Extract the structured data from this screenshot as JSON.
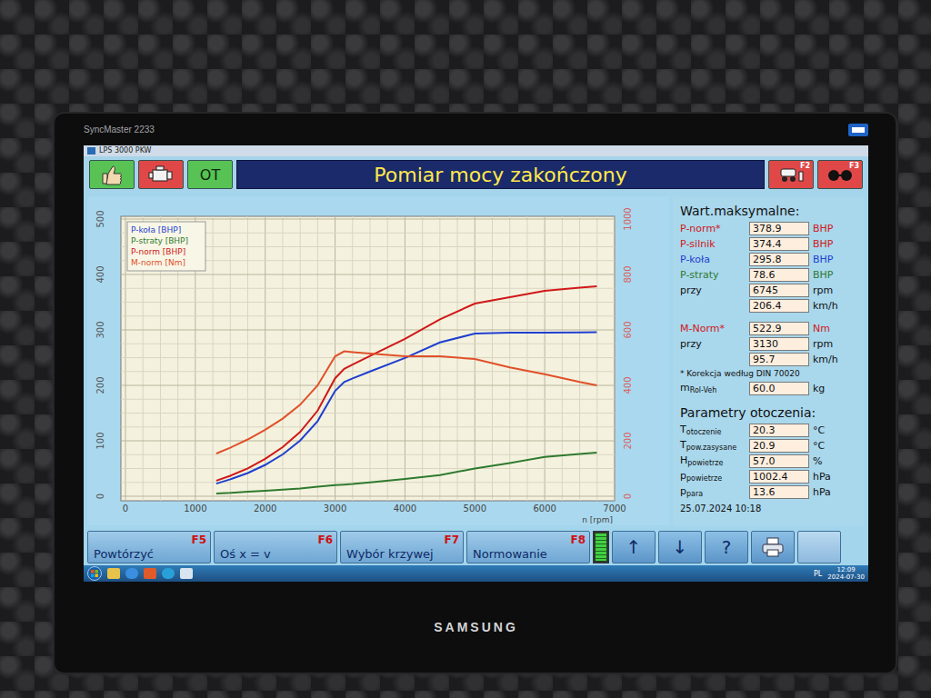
{
  "monitor": {
    "model": "SyncMaster 2233",
    "brand": "SAMSUNG"
  },
  "window": {
    "title": "LPS 3000 PKW"
  },
  "header": {
    "ok_button": "OT",
    "title": "Pomiar mocy zakończony",
    "right_buttons": [
      "F2",
      "F3"
    ]
  },
  "chart": {
    "left_ticks": [
      "0",
      "100",
      "200",
      "300",
      "400",
      "500"
    ],
    "right_ticks": [
      "0",
      "200",
      "400",
      "600",
      "800",
      "1000"
    ],
    "x_ticks": [
      "0",
      "1000",
      "2000",
      "3000",
      "4000",
      "5000",
      "6000",
      "7000"
    ],
    "x_label": "n [rpm]",
    "x_values": [
      1300,
      1500,
      1750,
      2000,
      2250,
      2500,
      2750,
      3000,
      3130,
      3250,
      3500,
      4000,
      4500,
      5000,
      5500,
      6000,
      6500,
      6745
    ],
    "series": [
      {
        "label": "P-koła [BHP]",
        "color": "#1f3fd0",
        "axis": "left",
        "values": [
          22.8,
          30.5,
          41.8,
          56.6,
          75.4,
          100.5,
          135.6,
          190.2,
          206.0,
          212.5,
          225.1,
          249.3,
          277.3,
          293.4,
          294.9,
          295.3,
          295.6,
          295.8
        ]
      },
      {
        "label": "P-straty [BHP]",
        "color": "#2f7a2f",
        "axis": "left",
        "values": [
          5,
          6,
          8,
          10,
          12,
          14,
          17,
          20,
          21,
          22,
          25,
          31,
          38,
          50,
          60,
          71,
          76,
          78.6
        ]
      },
      {
        "label": "P-norm [BHP]",
        "color": "#d01818",
        "axis": "left",
        "values": [
          28.1,
          36.9,
          50.4,
          67.4,
          88.5,
          115.9,
          154.5,
          212.8,
          229.8,
          237.3,
          253.1,
          283.7,
          319.1,
          347.6,
          359.2,
          370.7,
          376.1,
          378.9
        ]
      },
      {
        "label": "M-norm [Nm]",
        "color": "#e0502a",
        "axis": "right",
        "values": [
          154,
          175,
          205,
          240,
          280,
          330,
          400,
          505,
          522.9,
          520,
          515,
          505,
          505,
          495,
          465,
          440,
          412,
          400
        ]
      }
    ]
  },
  "panel": {
    "title": "Wart.maksymalne:",
    "power_rows": [
      {
        "label": "P-norm*",
        "value": "378.9",
        "unit": "BHP",
        "color": "#d01818"
      },
      {
        "label": "P-silnik",
        "value": "374.4",
        "unit": "BHP",
        "color": "#d01818"
      },
      {
        "label": "P-koła",
        "value": "295.8",
        "unit": "BHP",
        "color": "#1f3fd0"
      },
      {
        "label": "P-straty",
        "value": "78.6",
        "unit": "BHP",
        "color": "#2f7a2f"
      },
      {
        "label": "przy",
        "value": "6745",
        "unit": "rpm",
        "color": "#111111"
      },
      {
        "label": "",
        "value": "206.4",
        "unit": "km/h",
        "color": "#111111"
      }
    ],
    "torque_rows": [
      {
        "label": "M-Norm*",
        "value": "522.9",
        "unit": "Nm",
        "color": "#d01818"
      },
      {
        "label": "przy",
        "value": "3130",
        "unit": "rpm",
        "color": "#111111"
      },
      {
        "label": "",
        "value": "95.7",
        "unit": "km/h",
        "color": "#111111"
      }
    ],
    "footnote": "* Korekcja według DIN 70020",
    "mass": {
      "label": "m",
      "sub": "Rol-Veh",
      "value": "60.0",
      "unit": "kg"
    },
    "ambient_title": "Parametry otoczenia:",
    "ambient": [
      {
        "label": "T",
        "sub": "otoczenie",
        "value": "20.3",
        "unit": "°C"
      },
      {
        "label": "T",
        "sub": "pow.zasysane",
        "value": "20.9",
        "unit": "°C"
      },
      {
        "label": "H",
        "sub": "powietrze",
        "value": "57.0",
        "unit": "%"
      },
      {
        "label": "p",
        "sub": "powietrze",
        "value": "1002.4",
        "unit": "hPa"
      },
      {
        "label": "p",
        "sub": "para",
        "value": "13.6",
        "unit": "hPa"
      }
    ],
    "timestamp": "25.07.2024  10:18"
  },
  "keys": [
    {
      "label": "Powtórzyć",
      "key": "F5"
    },
    {
      "label": "Oś x = v",
      "key": "F6"
    },
    {
      "label": "Wybór krzywej",
      "key": "F7"
    },
    {
      "label": "Normowanie",
      "key": "F8"
    }
  ],
  "indicator": {
    "level": 1
  },
  "tools": [
    "↑",
    "↓",
    "?"
  ],
  "taskbar": {
    "lang": "PL",
    "time": "12:09",
    "date": "2024-07-30"
  }
}
